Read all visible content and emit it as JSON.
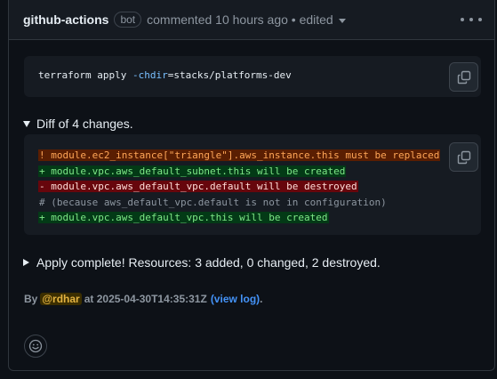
{
  "comment": {
    "author": "github-actions",
    "author_badge": "bot",
    "meta": "commented 10 hours ago • edited"
  },
  "command": {
    "prefix": "terraform apply ",
    "flag": "-chdir",
    "suffix": "=stacks/platforms-dev"
  },
  "diff": {
    "summary": "Diff of 4 changes.",
    "lines": [
      {
        "kind": "warn",
        "text": "! module.ec2_instance[\"triangle\"].aws_instance.this must be replaced"
      },
      {
        "kind": "add",
        "text": "+ module.vpc.aws_default_subnet.this will be created"
      },
      {
        "kind": "del",
        "text": "- module.vpc.aws_default_vpc.default will be destroyed"
      },
      {
        "kind": "comment",
        "text": "# (because aws_default_vpc.default is not in configuration)"
      },
      {
        "kind": "add",
        "text": "+ module.vpc.aws_default_vpc.this will be created"
      }
    ]
  },
  "apply": {
    "summary": "Apply complete! Resources: 3 added, 0 changed, 2 destroyed."
  },
  "byline": {
    "by": "By",
    "user": "@rdhar",
    "timestamp": "at 2025-04-30T14:35:31Z",
    "link_label": "(view log)",
    "end": "."
  },
  "colors": {
    "background": "#0d1117",
    "header": "#161b22",
    "link": "#4493f8",
    "mention": "#e3b341"
  },
  "icons": [
    "kebab-horizontal-icon",
    "copy-icon",
    "triangle-down-icon",
    "triangle-right-icon",
    "smiley-icon"
  ]
}
